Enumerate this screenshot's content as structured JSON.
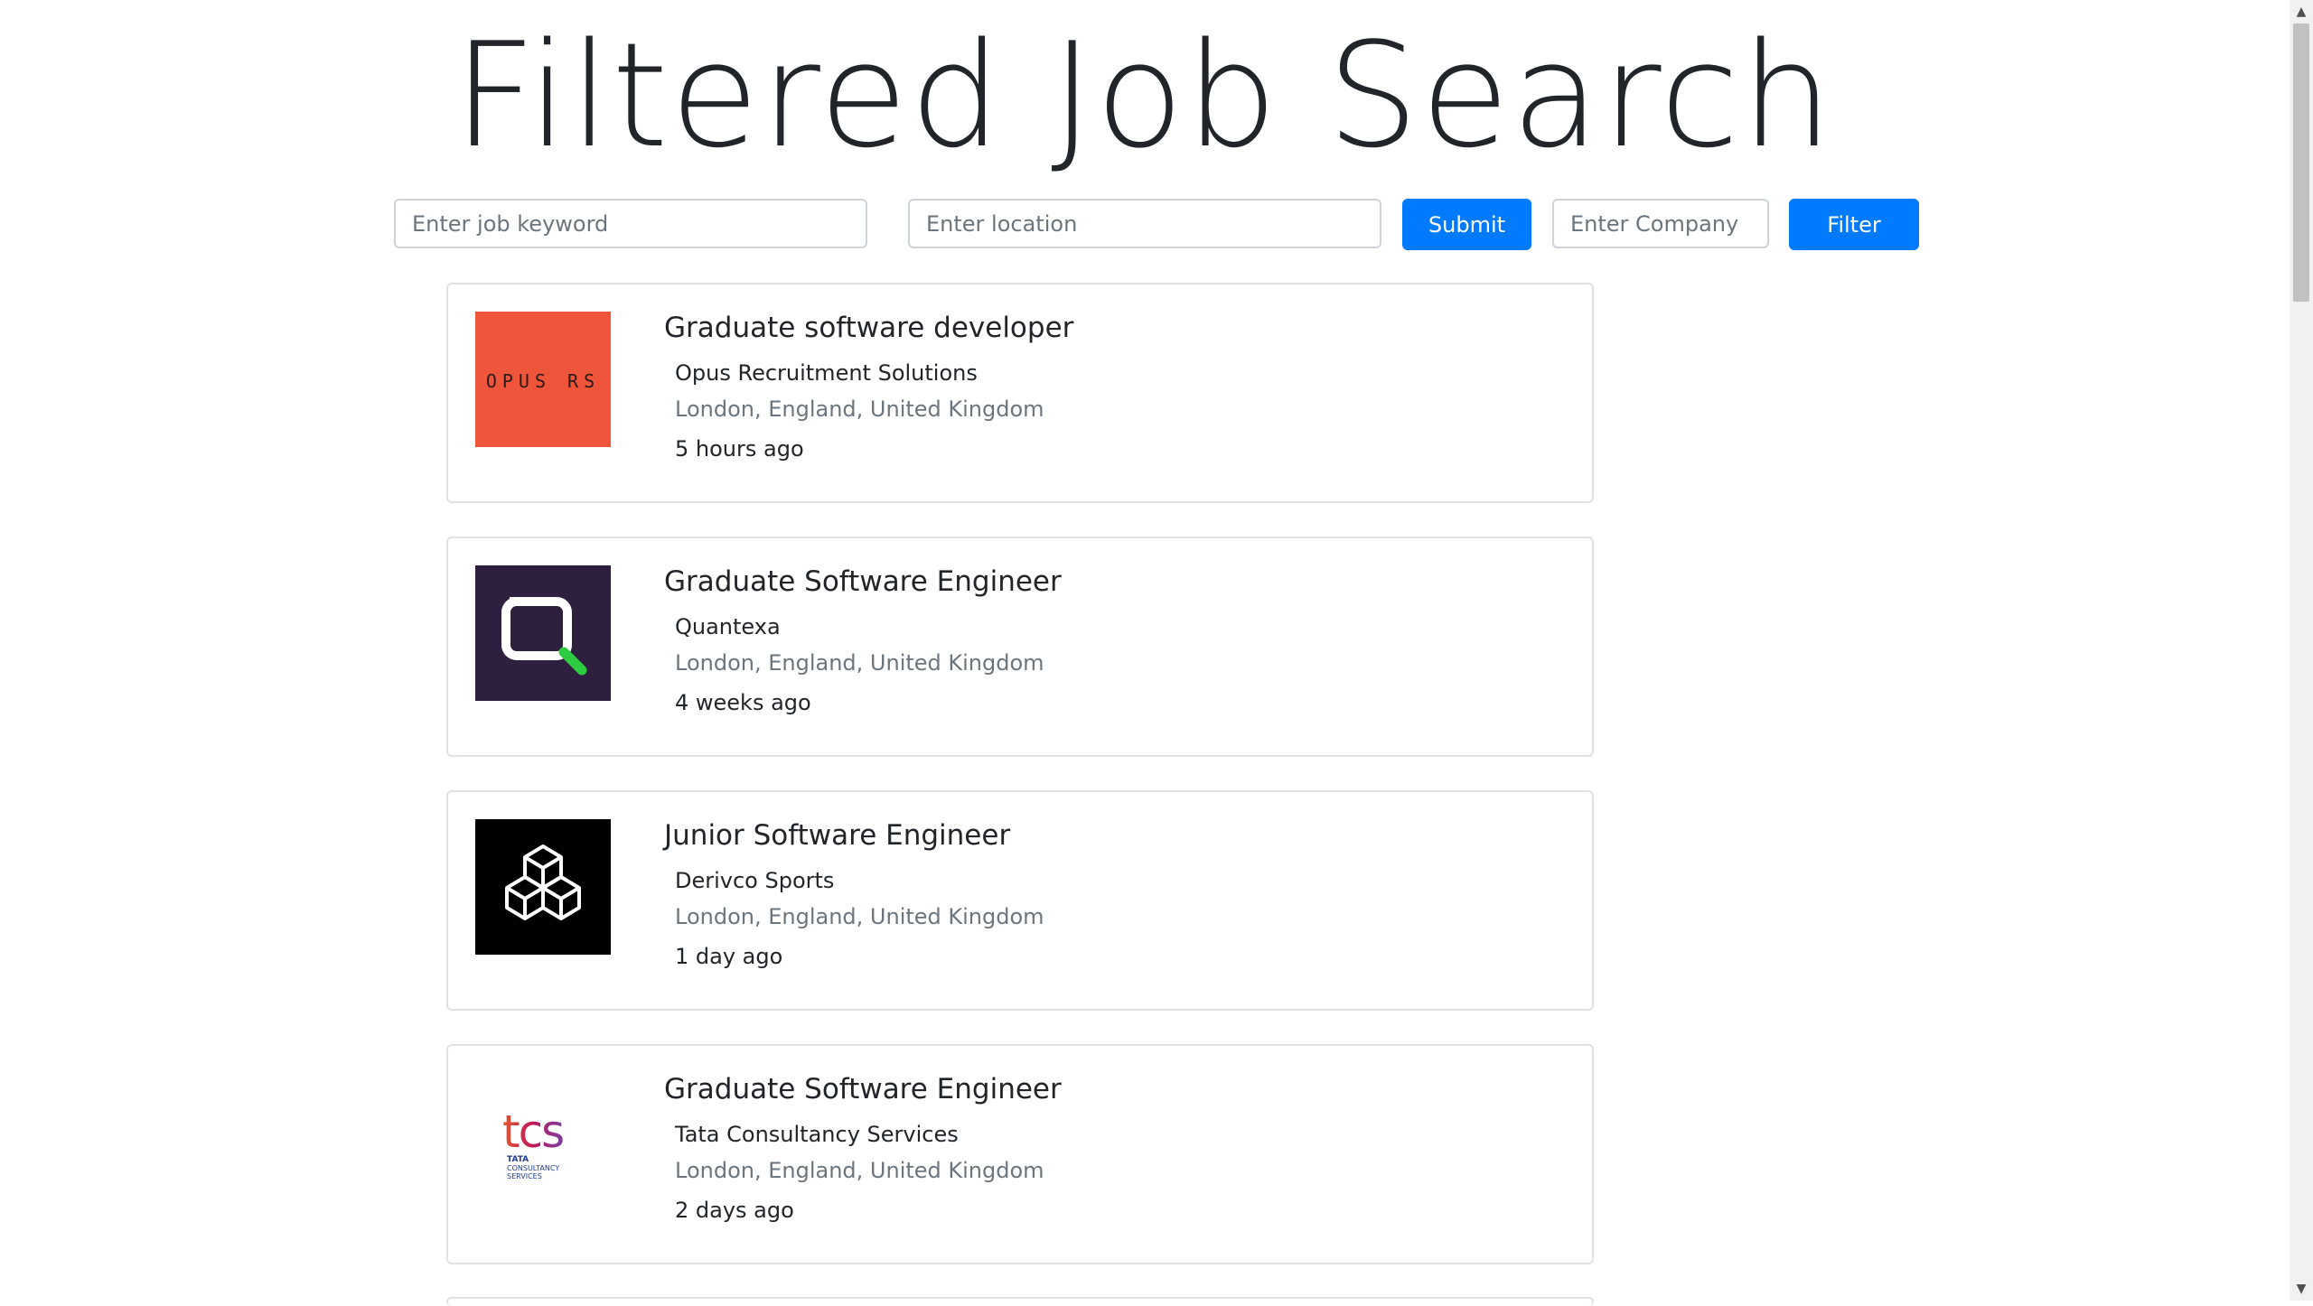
{
  "header": {
    "title": "Filtered Job Search"
  },
  "search": {
    "keyword_placeholder": "Enter job keyword",
    "location_placeholder": "Enter location",
    "submit_label": "Submit",
    "company_placeholder": "Enter Company",
    "filter_label": "Filter"
  },
  "jobs": [
    {
      "title": "Graduate software developer",
      "company": "Opus Recruitment Solutions",
      "location": "London, England, United Kingdom",
      "posted": "5 hours ago",
      "logo_icon": "opus-rs-logo",
      "logo_text": "OPUS RS",
      "logo_bg": "#ee553b"
    },
    {
      "title": "Graduate Software Engineer",
      "company": "Quantexa",
      "location": "London, England, United Kingdom",
      "posted": "4 weeks ago",
      "logo_icon": "quantexa-logo",
      "logo_bg": "#2d1f3d",
      "logo_accent": "#2ecc40"
    },
    {
      "title": "Junior Software Engineer",
      "company": "Derivco Sports",
      "location": "London, England, United Kingdom",
      "posted": "1 day ago",
      "logo_icon": "derivco-cubes-logo",
      "logo_bg": "#000000"
    },
    {
      "title": "Graduate Software Engineer",
      "company": "Tata Consultancy Services",
      "location": "London, England, United Kingdom",
      "posted": "2 days ago",
      "logo_icon": "tcs-logo",
      "logo_text": "tcs",
      "logo_subtext": [
        "TATA",
        "CONSULTANCY",
        "SERVICES"
      ]
    }
  ],
  "colors": {
    "primary": "#007bff",
    "muted": "#6c757d",
    "border": "#dee2e6"
  }
}
